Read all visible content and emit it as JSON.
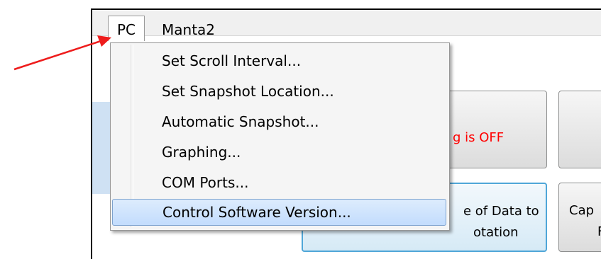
{
  "menubar": {
    "menus": [
      {
        "label": "PC",
        "open": true
      },
      {
        "label": "Manta2",
        "open": false
      }
    ]
  },
  "dropdown": {
    "items": [
      {
        "label": "Set Scroll Interval..."
      },
      {
        "label": "Set Snapshot Location..."
      },
      {
        "label": "Automatic Snapshot..."
      },
      {
        "label": "Graphing..."
      },
      {
        "label": "COM Ports..."
      },
      {
        "label": "Control Software Version...",
        "highlighted": true
      }
    ]
  },
  "buttons": {
    "logging": {
      "label": "g is OFF",
      "color": "#ff0000"
    },
    "rate": {
      "line1": "e of Data to",
      "line2": "otation"
    },
    "capture": {
      "line1": "Cap",
      "line2": "F"
    }
  },
  "annotation": {
    "arrow_color": "#ee1c1c",
    "points_to": "PC menu"
  },
  "colors": {
    "highlight": "#c2dcfd",
    "highlight_border": "#7da2ce",
    "focus_border": "#4fa6d8"
  }
}
